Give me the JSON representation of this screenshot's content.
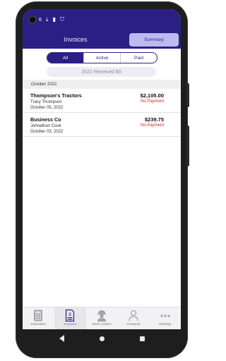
{
  "header": {
    "title": "Invoices",
    "summary_label": "Summary"
  },
  "status_bar": {
    "indicator": "6",
    "icons": [
      "download-icon",
      "sim-card-icon",
      "shield-icon"
    ]
  },
  "filters": {
    "items": [
      {
        "label": "All",
        "active": true
      },
      {
        "label": "Active",
        "active": false
      },
      {
        "label": "Paid",
        "active": false
      }
    ]
  },
  "received_text": "2022  Received $0",
  "section": {
    "label": "October 2022"
  },
  "invoices": [
    {
      "client": "Thompson's Tractors",
      "contact": "Tracy Thompson",
      "date": "October 05, 2022",
      "amount": "$2,105.00",
      "status": "No Payment"
    },
    {
      "client": "Business Co",
      "contact": "Johnathan Cook",
      "date": "October 03, 2022",
      "amount": "$239.75",
      "status": "No Payment"
    }
  ],
  "bottom_nav": {
    "items": [
      {
        "label": "Estimates",
        "icon": "calculator-icon"
      },
      {
        "label": "Invoices",
        "icon": "invoice-document-icon"
      },
      {
        "label": "Work Orders",
        "icon": "worker-icon"
      },
      {
        "label": "Contacts",
        "icon": "person-icon"
      },
      {
        "label": "Settings",
        "icon": "more-dots-icon"
      }
    ],
    "active_index": 1
  },
  "colors": {
    "brand": "#2b1f86",
    "summary_bg": "#bdbaf0",
    "no_payment": "#e02020"
  }
}
